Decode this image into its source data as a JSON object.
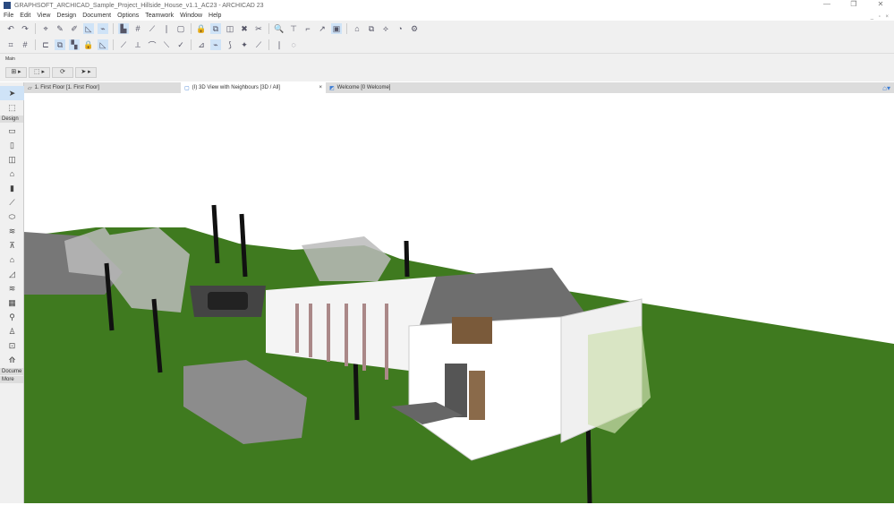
{
  "window": {
    "title": "GRAPHSOFT_ARCHICAD_Sample_Project_Hillside_House_v1.1_AC23 - ARCHICAD 23",
    "min": "—",
    "restore": "❐",
    "close": "✕"
  },
  "menu": [
    "File",
    "Edit",
    "View",
    "Design",
    "Document",
    "Options",
    "Teamwork",
    "Window",
    "Help"
  ],
  "doc_controls": "_ ▫ ×",
  "toolbar1": [
    "↶",
    "↷",
    "⌖",
    "✎",
    "✐",
    "◺",
    "⌁",
    "▙",
    "#",
    "⟋",
    "❘",
    "▢",
    "🔒",
    "⧉",
    "◫",
    "✖",
    "✂",
    "🔍",
    "⊤",
    "⌐",
    "↗",
    "▣",
    "⌂",
    "⧉",
    "⟡",
    "◔",
    "⚙"
  ],
  "toolbar2": [
    "⌗",
    "#",
    "⊏",
    "⧉",
    "▚",
    "🔒",
    "◺",
    "⟋",
    "⟂",
    "⌒",
    "⟍",
    "✓",
    "⊿",
    "⌁",
    "⟆",
    "✦",
    "⟋",
    "❘",
    "◌"
  ],
  "mainbar": {
    "label": "Main",
    "tools": [
      "⊞ ▸",
      "⬚ ▸",
      "⟳",
      "➤ ▸"
    ]
  },
  "tabs": [
    {
      "label": "1. First Floor [1. First Floor]"
    },
    {
      "label": "(I) 3D View with Neighbours [3D / All]",
      "close": "×"
    },
    {
      "label": "Welcome [0 Welcome]"
    }
  ],
  "toolbox": {
    "design_label": "Design",
    "document_label": "Docume",
    "more_label": "More",
    "top": [
      "➤",
      "⬚"
    ],
    "tools": [
      "▭",
      "▯",
      "◫",
      "⌂",
      "▮",
      "⟋",
      "⬭",
      "≋",
      "⊼",
      "⌂",
      "◿",
      "≋",
      "▦",
      "⚲",
      "♙",
      "⊡",
      "⟰"
    ]
  },
  "colors": {
    "accent": "#cfe3f7",
    "grass": "#3f7a1f"
  }
}
